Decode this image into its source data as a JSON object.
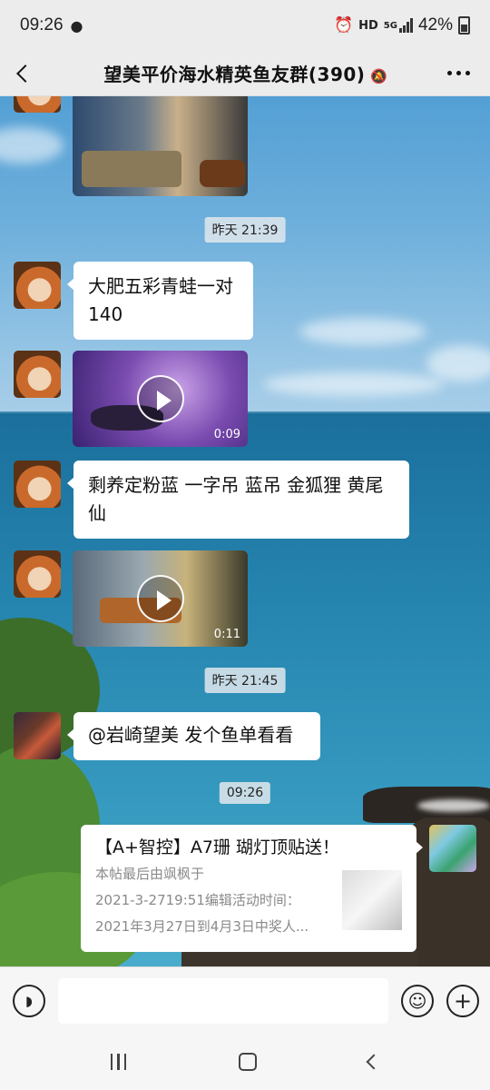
{
  "status_bar": {
    "time": "09:26",
    "network_label": "HD",
    "network_type": "5G",
    "battery_percent": "42%"
  },
  "header": {
    "title": "望美平价海水精英鱼友群(390)"
  },
  "messages": {
    "ts1": "昨天 21:39",
    "text1_line1": "大肥五彩青蛙一对",
    "text1_line2": "140",
    "video1_duration": "0:09",
    "text2_line1": "剩养定粉蓝 一字吊 蓝吊 金狐狸 黄尾",
    "text2_line2": "仙",
    "video2_duration": "0:11",
    "ts2": "昨天 21:45",
    "text3": "@岩崎望美  发个鱼单看看",
    "ts3": "09:26",
    "link_card": {
      "title": "【A+智控】A7珊 瑚灯顶贴送！",
      "desc_line1": "本帖最后由飒枫于",
      "desc_line2": "2021-3-2719:51编辑活动时间：",
      "desc_line3": "2021年3月27日到4月3日中奖人..."
    }
  },
  "input_bar": {
    "value": ""
  },
  "colors": {
    "header_bg": "#ececec",
    "bubble_bg": "#ffffff",
    "timestamp_bg": "#e1e8ec"
  },
  "icons": [
    "back-arrow-icon",
    "mute-bell-icon",
    "more-dots-icon",
    "voice-icon",
    "emoji-icon",
    "plus-icon",
    "play-icon",
    "nav-recent-icon",
    "nav-home-icon",
    "nav-back-icon"
  ]
}
